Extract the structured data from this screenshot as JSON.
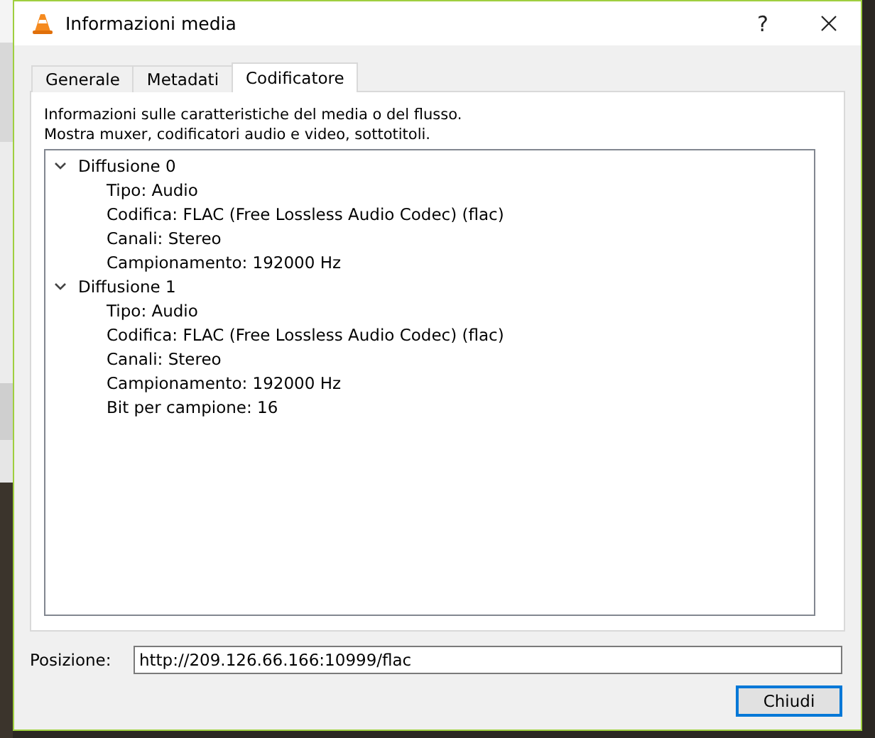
{
  "window": {
    "title": "Informazioni media",
    "help_button": "?"
  },
  "tabs": [
    {
      "label": "Generale",
      "selected": false
    },
    {
      "label": "Metadati",
      "selected": false
    },
    {
      "label": "Codificatore",
      "selected": true
    }
  ],
  "description": [
    "Informazioni sulle caratteristiche del media o del flusso.",
    "Mostra muxer, codificatori audio e video, sottotitoli."
  ],
  "tree": [
    {
      "label": "Diffusione 0",
      "expanded": true,
      "children": [
        {
          "label": "Tipo: Audio"
        },
        {
          "label": "Codifica: FLAC (Free Lossless Audio Codec) (flac)"
        },
        {
          "label": "Canali: Stereo"
        },
        {
          "label": "Campionamento: 192000 Hz"
        }
      ]
    },
    {
      "label": "Diffusione 1",
      "expanded": true,
      "children": [
        {
          "label": "Tipo: Audio"
        },
        {
          "label": "Codifica: FLAC (Free Lossless Audio Codec) (flac)"
        },
        {
          "label": "Canali: Stereo"
        },
        {
          "label": "Campionamento: 192000 Hz"
        },
        {
          "label": "Bit per campione: 16"
        }
      ]
    }
  ],
  "location": {
    "label": "Posizione:",
    "value": "http://209.126.66.166:10999/flac"
  },
  "buttons": [
    "Chiudi"
  ]
}
